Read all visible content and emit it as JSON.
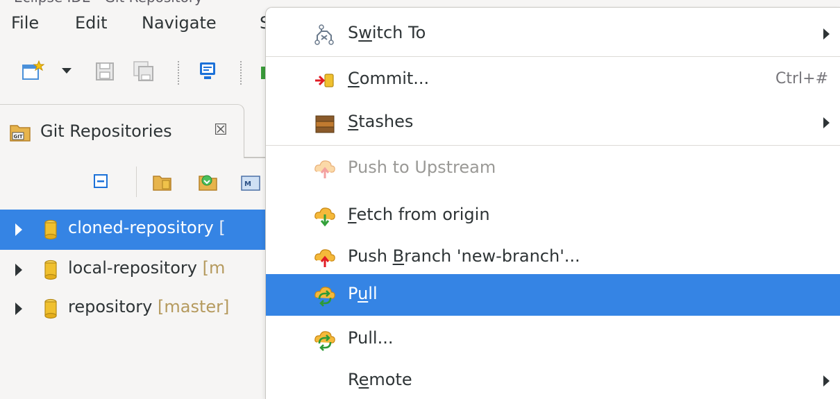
{
  "window": {
    "title_fragment": "Eclipse IDE - Git Repository"
  },
  "menubar": {
    "file": "File",
    "edit": "Edit",
    "navigate": "Navigate",
    "cut_off": "S"
  },
  "view": {
    "tab_title": "Git Repositories",
    "close_glyph": "☒"
  },
  "repositories": [
    {
      "name": "cloned-repository",
      "branch": "[",
      "selected": true
    },
    {
      "name": "local-repository",
      "branch": "[m",
      "selected": false
    },
    {
      "name": "repository",
      "branch": "[master]",
      "selected": false
    }
  ],
  "context_menu": {
    "switch_to": {
      "pre": "S",
      "mn": "w",
      "post": "itch To"
    },
    "commit": {
      "pre": "",
      "mn": "C",
      "post": "ommit...",
      "accel": "Ctrl+#"
    },
    "stashes": {
      "pre": "",
      "mn": "S",
      "post": "tashes"
    },
    "push_upstream": {
      "label": "Push to Upstream"
    },
    "fetch_origin": {
      "pre": "",
      "mn": "F",
      "post": "etch from origin"
    },
    "push_branch": {
      "pre": "Push ",
      "mn": "B",
      "post": "ranch 'new-branch'..."
    },
    "pull": {
      "pre": "P",
      "mn": "u",
      "post": "ll"
    },
    "pull_dialog": {
      "label": "Pull..."
    },
    "remote": {
      "pre": "R",
      "mn": "e",
      "post": "mote"
    }
  },
  "colors": {
    "selection": "#3584e4",
    "branch_decorator": "#b59a5e",
    "disabled_text": "#9a9996"
  }
}
